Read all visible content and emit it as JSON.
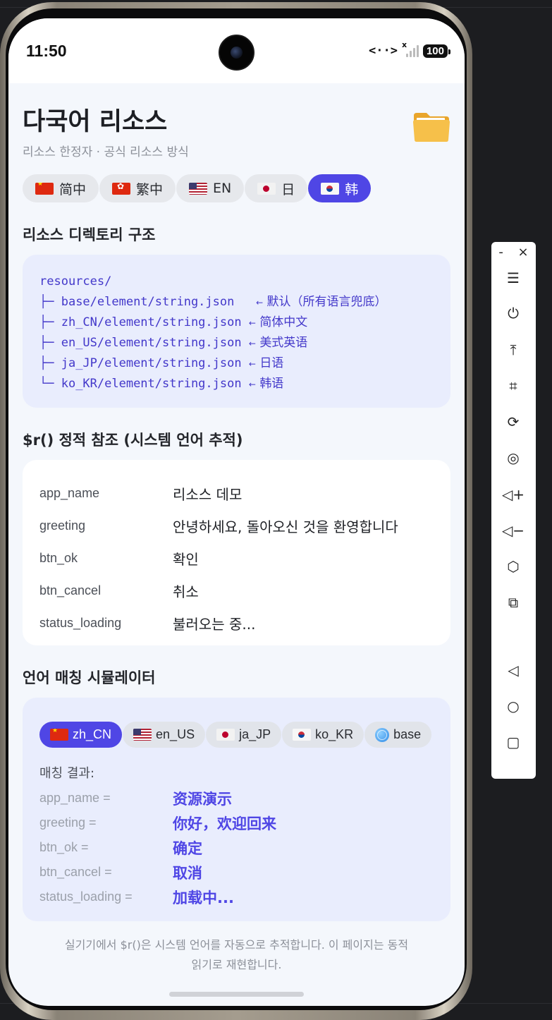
{
  "status": {
    "time": "11:50",
    "data_indicator": "<··>",
    "signal_x": "x",
    "battery": "100"
  },
  "header": {
    "title": "다국어 리소스",
    "subtitle": "리소스 한정자 · 공식 리소스 방식",
    "folder_icon": "folder-icon"
  },
  "lang_tabs": [
    {
      "label": "简中",
      "flag": "cn"
    },
    {
      "label": "繁中",
      "flag": "hk"
    },
    {
      "label": "EN",
      "flag": "us"
    },
    {
      "label": "日",
      "flag": "jp"
    },
    {
      "label": "韩",
      "flag": "kr",
      "active": true
    }
  ],
  "directory": {
    "title": "리소스 디렉토리 구조",
    "root": "resources/",
    "entries": [
      {
        "prefix": "├─ ",
        "path": "base/element/string.json",
        "pad": "   ",
        "note": "默认（所有语言兜底）"
      },
      {
        "prefix": "├─ ",
        "path": "zh_CN/element/string.json",
        "pad": " ",
        "note": "简体中文"
      },
      {
        "prefix": "├─ ",
        "path": "en_US/element/string.json",
        "pad": " ",
        "note": "美式英语"
      },
      {
        "prefix": "├─ ",
        "path": "ja_JP/element/string.json",
        "pad": " ",
        "note": "日语"
      },
      {
        "prefix": "└─ ",
        "path": "ko_KR/element/string.json",
        "pad": " ",
        "note": "韩语"
      }
    ],
    "arrow": "←"
  },
  "static_ref": {
    "title": "$r() 정적 참조 (시스템 언어 추적)",
    "rows": [
      {
        "key": "app_name",
        "value": "리소스 데모"
      },
      {
        "key": "greeting",
        "value": "안녕하세요, 돌아오신 것을 환영합니다"
      },
      {
        "key": "btn_ok",
        "value": "확인"
      },
      {
        "key": "btn_cancel",
        "value": "취소"
      },
      {
        "key": "status_loading",
        "value": "불러오는 중..."
      }
    ]
  },
  "simulator": {
    "title": "언어 매칭 시뮬레이터",
    "tabs": [
      {
        "label": "zh_CN",
        "flag": "cn",
        "active": true
      },
      {
        "label": "en_US",
        "flag": "us"
      },
      {
        "label": "ja_JP",
        "flag": "jp"
      },
      {
        "label": "ko_KR",
        "flag": "kr"
      },
      {
        "label": "base",
        "flag": "globe"
      }
    ],
    "match_label": "매칭 결과:",
    "rows": [
      {
        "key": "app_name =",
        "value": "资源演示"
      },
      {
        "key": "greeting =",
        "value": "你好，欢迎回来"
      },
      {
        "key": "btn_ok =",
        "value": "确定"
      },
      {
        "key": "btn_cancel =",
        "value": "取消"
      },
      {
        "key": "status_loading =",
        "value": "加载中..."
      }
    ]
  },
  "footer": {
    "line1": "실기기에서 $r()은 시스템 언어를 자동으로 추적합니다. 이 페이지는 동적",
    "line2": "읽기로 재현합니다."
  },
  "side_toolbar": {
    "minimize": "-",
    "close": "×",
    "buttons": [
      {
        "name": "menu-icon",
        "glyph": "☰"
      },
      {
        "name": "power-icon",
        "glyph": "⏻"
      },
      {
        "name": "pin-top-icon",
        "glyph": "⤒"
      },
      {
        "name": "crop-icon",
        "glyph": "⌗"
      },
      {
        "name": "rotate-icon",
        "glyph": "⟳"
      },
      {
        "name": "record-icon",
        "glyph": "◎"
      },
      {
        "name": "volume-up-icon",
        "glyph": "◁+"
      },
      {
        "name": "volume-down-icon",
        "glyph": "◁−"
      },
      {
        "name": "shake-icon",
        "glyph": "⬡"
      },
      {
        "name": "screens-icon",
        "glyph": "⧉"
      },
      {
        "name": "back-icon",
        "glyph": "◁"
      },
      {
        "name": "home-icon",
        "glyph": "○"
      },
      {
        "name": "recents-icon",
        "glyph": "▢"
      }
    ]
  }
}
